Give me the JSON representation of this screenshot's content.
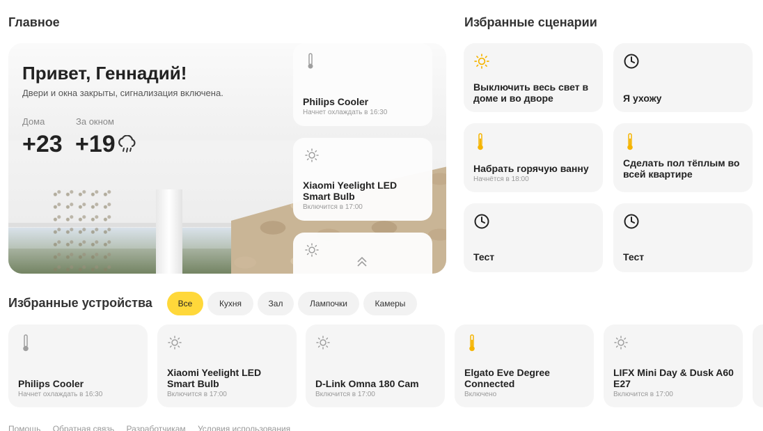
{
  "main": {
    "title": "Главное"
  },
  "hero": {
    "greeting": "Привет, Геннадий!",
    "status": "Двери и окна закрыты, сигнализация включена.",
    "home_label": "Дома",
    "home_temp": "+23",
    "outside_label": "За окном",
    "outside_temp": "+19",
    "cards": [
      {
        "name": "Philips Cooler",
        "sub": "Начнет охлаждать в 16:30",
        "icon": "thermometer-icon"
      },
      {
        "name": "Xiaomi Yeelight LED Smart Bulb",
        "sub": "Включится в 17:00",
        "icon": "sun-icon"
      }
    ]
  },
  "scenarios": {
    "title": "Избранные сценарии",
    "items": [
      {
        "label": "Выключить весь свет в доме и во дворе",
        "sub": "",
        "icon": "sun-icon"
      },
      {
        "label": "Я ухожу",
        "sub": "",
        "icon": "clock-icon"
      },
      {
        "label": "Набрать горячую ванну",
        "sub": "Начнётся в 18:00",
        "icon": "thermometer-icon"
      },
      {
        "label": "Сделать пол тёплым во всей квартире",
        "sub": "",
        "icon": "thermometer-icon"
      },
      {
        "label": "Тест",
        "sub": "",
        "icon": "clock-icon"
      },
      {
        "label": "Тест",
        "sub": "",
        "icon": "clock-icon"
      }
    ]
  },
  "devices": {
    "title": "Избранные устройства",
    "tabs": [
      "Все",
      "Кухня",
      "Зал",
      "Лампочки",
      "Камеры"
    ],
    "active_tab": "Все",
    "items": [
      {
        "name": "Philips Cooler",
        "sub": "Начнет охлаждать в 16:30",
        "icon": "thermometer-icon"
      },
      {
        "name": "Xiaomi Yeelight LED Smart Bulb",
        "sub": "Включится в 17:00",
        "icon": "sun-icon"
      },
      {
        "name": "D-Link Omna 180 Cam",
        "sub": "Включится в 17:00",
        "icon": "sun-icon"
      },
      {
        "name": "Elgato Eve Degree Connected",
        "sub": "Включено",
        "icon": "thermometer-icon"
      },
      {
        "name": "LIFX Mini Day & Dusk A60 E27",
        "sub": "Включится в 17:00",
        "icon": "sun-icon"
      }
    ]
  },
  "footer": {
    "links": [
      "Помощь",
      "Обратная связь",
      "Разработчикам",
      "Условия использования"
    ]
  },
  "colors": {
    "accent": "#ffd83a",
    "icon_active": "#f5b400",
    "icon_muted": "#9e9e9e",
    "card_bg": "#f5f5f5"
  }
}
